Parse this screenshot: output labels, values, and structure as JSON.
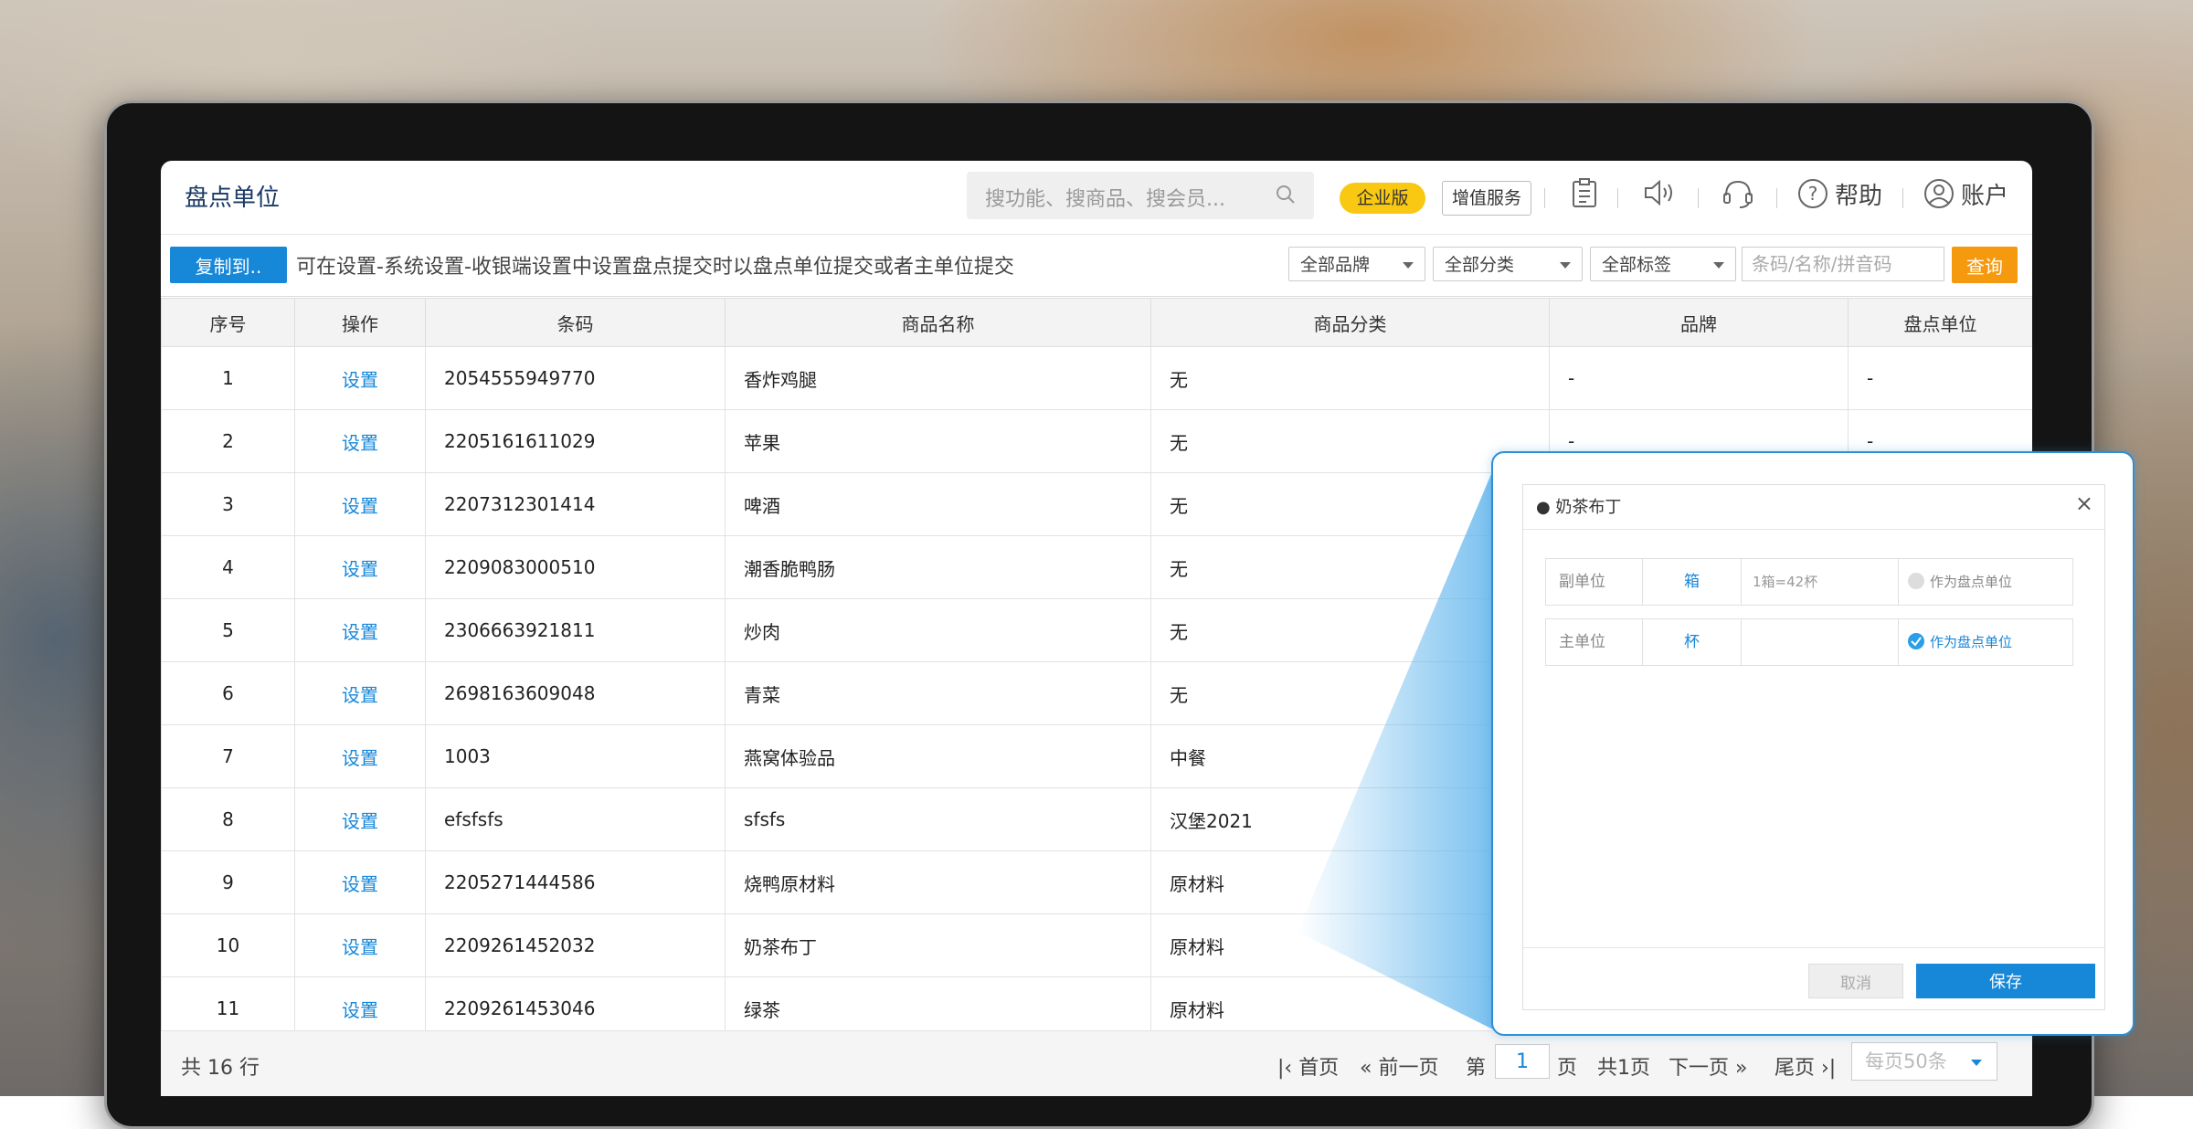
{
  "header": {
    "title": "盘点单位",
    "search_placeholder": "搜功能、搜商品、搜会员...",
    "badge_enterprise": "企业版",
    "value_added": "增值服务",
    "help": "帮助",
    "account": "账户"
  },
  "toolbar": {
    "copy_button": "复制到..",
    "tip": "可在设置-系统设置-收银端设置中设置盘点提交时以盘点单位提交或者主单位提交",
    "filter_brand": "全部品牌",
    "filter_category": "全部分类",
    "filter_tag": "全部标签",
    "query_placeholder": "条码/名称/拼音码",
    "query_button": "查询"
  },
  "table": {
    "columns": [
      "序号",
      "操作",
      "条码",
      "商品名称",
      "商品分类",
      "品牌",
      "盘点单位"
    ],
    "rows": [
      {
        "no": "1",
        "op": "设置",
        "barcode": "2054555949770",
        "name": "香炸鸡腿",
        "category": "无",
        "brand": "-",
        "unit": "-"
      },
      {
        "no": "2",
        "op": "设置",
        "barcode": "2205161611029",
        "name": "苹果",
        "category": "无",
        "brand": "-",
        "unit": "-"
      },
      {
        "no": "3",
        "op": "设置",
        "barcode": "2207312301414",
        "name": "啤酒",
        "category": "无",
        "brand": "",
        "unit": ""
      },
      {
        "no": "4",
        "op": "设置",
        "barcode": "2209083000510",
        "name": "潮香脆鸭肠",
        "category": "无",
        "brand": "",
        "unit": ""
      },
      {
        "no": "5",
        "op": "设置",
        "barcode": "2306663921811",
        "name": "炒肉",
        "category": "无",
        "brand": "",
        "unit": ""
      },
      {
        "no": "6",
        "op": "设置",
        "barcode": "2698163609048",
        "name": "青菜",
        "category": "无",
        "brand": "",
        "unit": ""
      },
      {
        "no": "7",
        "op": "设置",
        "barcode": "1003",
        "name": "燕窝体验品",
        "category": "中餐",
        "brand": "",
        "unit": ""
      },
      {
        "no": "8",
        "op": "设置",
        "barcode": "efsfsfs",
        "name": "sfsfs",
        "category": "汉堡2021",
        "brand": "",
        "unit": ""
      },
      {
        "no": "9",
        "op": "设置",
        "barcode": "2205271444586",
        "name": "烧鸭原材料",
        "category": "原材料",
        "brand": "",
        "unit": ""
      },
      {
        "no": "10",
        "op": "设置",
        "barcode": "2209261452032",
        "name": "奶茶布丁",
        "category": "原材料",
        "brand": "",
        "unit": ""
      },
      {
        "no": "11",
        "op": "设置",
        "barcode": "2209261453046",
        "name": "绿茶",
        "category": "原材料",
        "brand": "",
        "unit": ""
      }
    ]
  },
  "footer": {
    "total": "共 16 行",
    "first": "首页",
    "prev": "前一页",
    "page_prefix": "第",
    "page_value": "1",
    "page_suffix": "页",
    "page_count": "共1页",
    "next": "下一页",
    "last": "尾页",
    "per_page": "每页50条"
  },
  "dialog": {
    "title": "● 奶茶布丁",
    "close": "×",
    "rows": [
      {
        "label": "副单位",
        "unit": "箱",
        "ratio": "1箱=42杯",
        "option": "作为盘点单位",
        "selected": false
      },
      {
        "label": "主单位",
        "unit": "杯",
        "ratio": "",
        "option": "作为盘点单位",
        "selected": true
      }
    ],
    "cancel": "取消",
    "save": "保存"
  },
  "colors": {
    "accent_blue": "#1787d8",
    "query_orange": "#f59a0e",
    "enterprise_yellow": "#f8c813",
    "title_navy": "#1b3a66"
  }
}
